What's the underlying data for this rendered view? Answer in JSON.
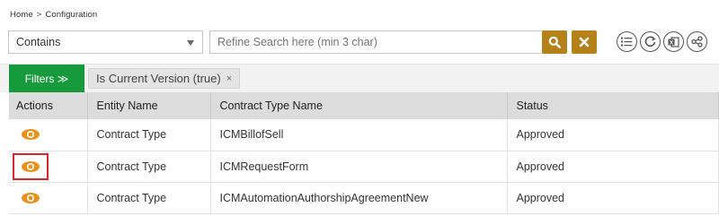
{
  "breadcrumb": {
    "home": "Home",
    "separator": ">",
    "current": "Configuration"
  },
  "search": {
    "select_value": "Contains",
    "input_placeholder": "Refine Search here (min 3 char)",
    "search_button_icon": "search-icon",
    "clear_button_icon": "close-icon"
  },
  "toolbar_icons": [
    "list-icon",
    "refresh-icon",
    "excel-export-icon",
    "share-icon"
  ],
  "filters": {
    "button_label": "Filters ≫",
    "chip_label": "Is Current Version (true)",
    "chip_close": "×"
  },
  "grid": {
    "columns": [
      "Actions",
      "Entity Name",
      "Contract Type Name",
      "Status"
    ],
    "rows": [
      {
        "entity": "Contract Type",
        "contract_type": "ICMBillofSell",
        "status": "Approved",
        "selected": false
      },
      {
        "entity": "Contract Type",
        "contract_type": "ICMRequestForm",
        "status": "Approved",
        "selected": true
      },
      {
        "entity": "Contract Type",
        "contract_type": "ICMAutomationAuthorshipAgreementNew",
        "status": "Approved",
        "selected": false
      }
    ]
  },
  "colors": {
    "accent": "#b5821a",
    "filters_green": "#179a3b",
    "eye_orange": "#e8921b",
    "selected_border": "#d9262a",
    "header_gray": "#dcdcdc"
  }
}
